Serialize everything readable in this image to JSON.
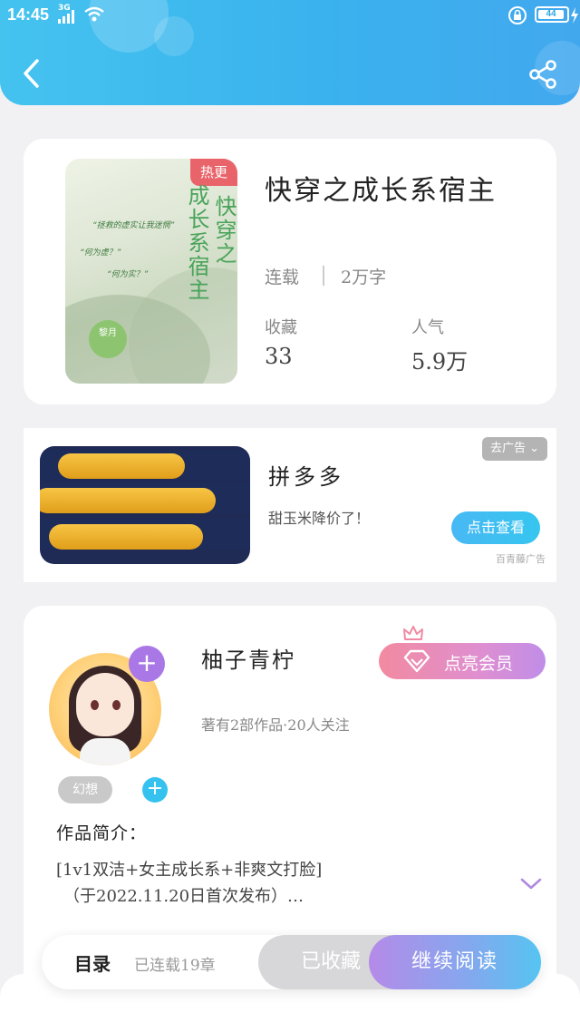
{
  "status_bar": {
    "time": "14:45",
    "network": "3G",
    "battery": "44"
  },
  "book": {
    "badge": "热更",
    "cover_title_lines": [
      "快穿之",
      "成长系宿主"
    ],
    "cover_quotes": [
      "“拯救的虚实让我迷惘”",
      "“何为虚？”",
      "“何为实？”"
    ],
    "cover_author": "黎月",
    "title": "快穿之成长系宿主",
    "status": "连载",
    "words": "2万字",
    "stats": [
      {
        "label": "收藏",
        "value": "33"
      },
      {
        "label": "人气",
        "value": "5.9万"
      }
    ]
  },
  "ad": {
    "remove_label": "去广告 ⌄",
    "title": "拼多多",
    "description": "甜玉米降价了！",
    "button_label": "点击查看",
    "source": "百青藤广告"
  },
  "author": {
    "follow_label": "+",
    "name": "柚子青柠",
    "vip_label": "点亮会员",
    "meta": "著有2部作品·20人关注",
    "tag": "幻想",
    "add_tag_label": "+",
    "intro_heading": "作品简介：",
    "intro_line1": "[1v1双洁+女主成长系+非爽文打脸]",
    "intro_line2": "（于2022.11.20日首次发布）…"
  },
  "bottom_bar": {
    "toc_label": "目录",
    "chapter_count": "已连载19章",
    "collected_label": "已收藏",
    "continue_label": "继续阅读"
  },
  "colors": {
    "header": "#3ab2ee",
    "badge": "#e9646a",
    "accent_blue": "#35c2ef",
    "accent_purple": "#a978e6"
  },
  "icons": [
    "signal-icon",
    "wifi-icon",
    "lock-icon",
    "charge-icon",
    "back-icon",
    "share-icon",
    "crown-icon",
    "diamond-icon",
    "expand-icon"
  ]
}
